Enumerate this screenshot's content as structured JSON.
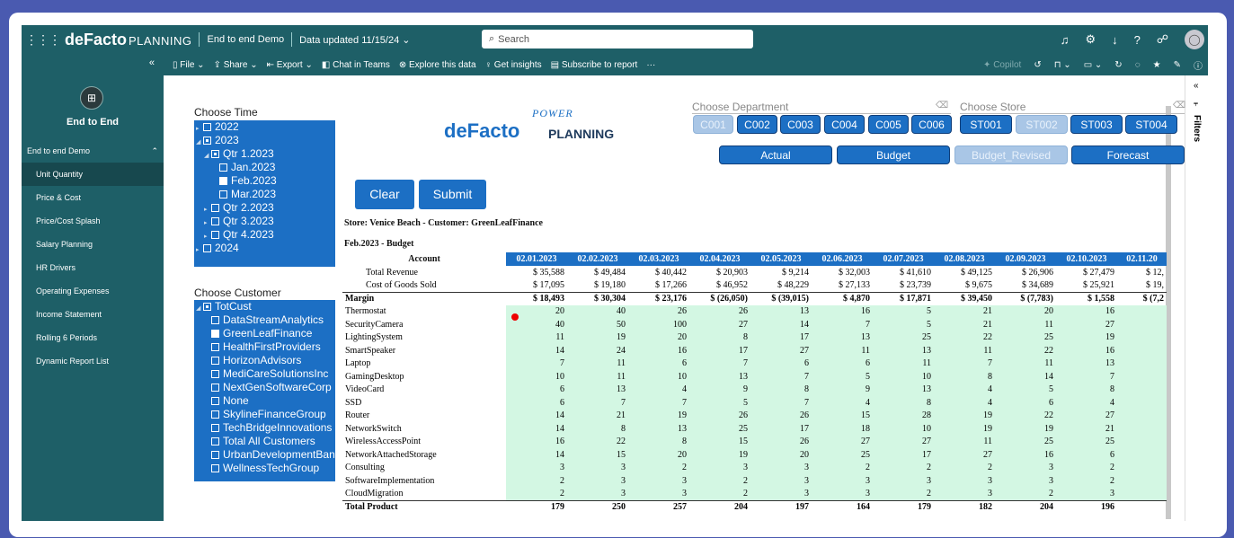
{
  "header": {
    "brand": "deFacto",
    "brand_suffix": "PLANNING",
    "report_name": "End to end Demo",
    "updated": "Data updated 11/15/24",
    "search_placeholder": "Search"
  },
  "toolbar": {
    "items": [
      "File",
      "Share",
      "Export",
      "Chat in Teams",
      "Explore this data",
      "Get insights",
      "Subscribe to report",
      "···"
    ],
    "copilot": "Copilot"
  },
  "sidebar": {
    "title": "End to End",
    "group": "End to end Demo",
    "items": [
      {
        "label": "Unit Quantity",
        "active": true
      },
      {
        "label": "Price & Cost"
      },
      {
        "label": "Price/Cost Splash"
      },
      {
        "label": "Salary Planning"
      },
      {
        "label": "HR Drivers"
      },
      {
        "label": "Operating Expenses"
      },
      {
        "label": "Income Statement"
      },
      {
        "label": "Rolling 6 Periods"
      },
      {
        "label": "Dynamic Report List"
      }
    ]
  },
  "filters_label": "Filters",
  "time_slicer": {
    "title": "Choose Time",
    "items": [
      {
        "label": "2022",
        "level": 0,
        "arrow": true,
        "check": "none"
      },
      {
        "label": "2023",
        "level": 0,
        "arrow": true,
        "check": "part",
        "open": true
      },
      {
        "label": "Qtr 1.2023",
        "level": 1,
        "arrow": true,
        "check": "part",
        "open": true
      },
      {
        "label": "Jan.2023",
        "level": 2,
        "check": "none"
      },
      {
        "label": "Feb.2023",
        "level": 2,
        "check": "full"
      },
      {
        "label": "Mar.2023",
        "level": 2,
        "check": "none"
      },
      {
        "label": "Qtr 2.2023",
        "level": 1,
        "arrow": true,
        "check": "none"
      },
      {
        "label": "Qtr 3.2023",
        "level": 1,
        "arrow": true,
        "check": "none"
      },
      {
        "label": "Qtr 4.2023",
        "level": 1,
        "arrow": true,
        "check": "none"
      },
      {
        "label": "2024",
        "level": 0,
        "arrow": true,
        "check": "none"
      }
    ]
  },
  "customer_slicer": {
    "title": "Choose Customer",
    "items": [
      {
        "label": "TotCust",
        "level": 0,
        "arrow": true,
        "check": "part",
        "open": true
      },
      {
        "label": "DataStreamAnalytics",
        "level": 1,
        "check": "none"
      },
      {
        "label": "GreenLeafFinance",
        "level": 1,
        "check": "full"
      },
      {
        "label": "HealthFirstProviders",
        "level": 1,
        "check": "none"
      },
      {
        "label": "HorizonAdvisors",
        "level": 1,
        "check": "none"
      },
      {
        "label": "MediCareSolutionsInc",
        "level": 1,
        "check": "none"
      },
      {
        "label": "NextGenSoftwareCorp",
        "level": 1,
        "check": "none"
      },
      {
        "label": "None",
        "level": 1,
        "check": "none"
      },
      {
        "label": "SkylineFinanceGroup",
        "level": 1,
        "check": "none"
      },
      {
        "label": "TechBridgeInnovations",
        "level": 1,
        "check": "none"
      },
      {
        "label": "Total All Customers",
        "level": 1,
        "check": "none"
      },
      {
        "label": "UrbanDevelopmentBank",
        "level": 1,
        "check": "none"
      },
      {
        "label": "WellnessTechGroup",
        "level": 1,
        "check": "none"
      }
    ]
  },
  "logo": {
    "power": "POWER",
    "defacto": "deFacto",
    "planning": "PLANNING"
  },
  "department": {
    "title": "Choose Department",
    "items": [
      {
        "label": "C001",
        "selected": true
      },
      {
        "label": "C002"
      },
      {
        "label": "C003"
      },
      {
        "label": "C004"
      },
      {
        "label": "C005"
      },
      {
        "label": "C006"
      }
    ]
  },
  "store": {
    "title": "Choose Store",
    "items": [
      {
        "label": "ST001"
      },
      {
        "label": "ST002",
        "selected": true
      },
      {
        "label": "ST003"
      },
      {
        "label": "ST004"
      }
    ]
  },
  "scenario": [
    {
      "label": "Actual"
    },
    {
      "label": "Budget"
    },
    {
      "label": "Budget_Revised",
      "selected": true
    },
    {
      "label": "Forecast"
    }
  ],
  "actions": {
    "clear": "Clear",
    "submit": "Submit"
  },
  "context": {
    "store_line": "Store: Venice Beach - Customer: GreenLeafFinance",
    "period_line": "Feb.2023 - Budget"
  },
  "table": {
    "account_header": "Account",
    "columns": [
      "02.01.2023",
      "02.02.2023",
      "02.03.2023",
      "02.04.2023",
      "02.05.2023",
      "02.06.2023",
      "02.07.2023",
      "02.08.2023",
      "02.09.2023",
      "02.10.2023",
      "02.11.20"
    ],
    "summary_rows": [
      {
        "label": "Total Revenue",
        "values": [
          "$ 35,588",
          "$ 49,484",
          "$ 40,442",
          "$ 20,903",
          "$ 9,214",
          "$ 32,003",
          "$ 41,610",
          "$ 49,125",
          "$ 26,906",
          "$ 27,479",
          "$ 12,"
        ]
      },
      {
        "label": "Cost of Goods Sold",
        "values": [
          "$ 17,095",
          "$ 19,180",
          "$ 17,266",
          "$ 46,952",
          "$ 48,229",
          "$ 27,133",
          "$ 23,739",
          "$ 9,675",
          "$ 34,689",
          "$ 25,921",
          "$ 19,"
        ]
      }
    ],
    "margin_row": {
      "label": "Margin",
      "values": [
        "$ 18,493",
        "$ 30,304",
        "$ 23,176",
        "$ (26,050)",
        "$ (39,015)",
        "$ 4,870",
        "$ 17,871",
        "$ 39,450",
        "$ (7,783)",
        "$ 1,558",
        "$ (7,2"
      ]
    },
    "product_rows": [
      {
        "label": "Thermostat",
        "values": [
          "20",
          "40",
          "26",
          "26",
          "13",
          "16",
          "5",
          "21",
          "20",
          "16",
          ""
        ]
      },
      {
        "label": "SecurityCamera",
        "values": [
          "40",
          "50",
          "100",
          "27",
          "14",
          "7",
          "5",
          "21",
          "11",
          "27",
          ""
        ]
      },
      {
        "label": "LightingSystem",
        "values": [
          "11",
          "19",
          "20",
          "8",
          "17",
          "13",
          "25",
          "22",
          "25",
          "19",
          ""
        ]
      },
      {
        "label": "SmartSpeaker",
        "values": [
          "14",
          "24",
          "16",
          "17",
          "27",
          "11",
          "13",
          "11",
          "22",
          "16",
          ""
        ]
      },
      {
        "label": "Laptop",
        "values": [
          "7",
          "11",
          "6",
          "7",
          "6",
          "6",
          "11",
          "7",
          "11",
          "13",
          ""
        ]
      },
      {
        "label": "GamingDesktop",
        "values": [
          "10",
          "11",
          "10",
          "13",
          "7",
          "5",
          "10",
          "8",
          "14",
          "7",
          ""
        ]
      },
      {
        "label": "VideoCard",
        "values": [
          "6",
          "13",
          "4",
          "9",
          "8",
          "9",
          "13",
          "4",
          "5",
          "8",
          ""
        ]
      },
      {
        "label": "SSD",
        "values": [
          "6",
          "7",
          "7",
          "5",
          "7",
          "4",
          "8",
          "4",
          "6",
          "4",
          ""
        ]
      },
      {
        "label": "Router",
        "values": [
          "14",
          "21",
          "19",
          "26",
          "26",
          "15",
          "28",
          "19",
          "22",
          "27",
          ""
        ]
      },
      {
        "label": "NetworkSwitch",
        "values": [
          "14",
          "8",
          "13",
          "25",
          "17",
          "18",
          "10",
          "19",
          "19",
          "21",
          ""
        ]
      },
      {
        "label": "WirelessAccessPoint",
        "values": [
          "16",
          "22",
          "8",
          "15",
          "26",
          "27",
          "27",
          "11",
          "25",
          "25",
          ""
        ]
      },
      {
        "label": "NetworkAttachedStorage",
        "values": [
          "14",
          "15",
          "20",
          "19",
          "20",
          "25",
          "17",
          "27",
          "16",
          "6",
          ""
        ]
      },
      {
        "label": "Consulting",
        "values": [
          "3",
          "3",
          "2",
          "3",
          "3",
          "2",
          "2",
          "2",
          "3",
          "2",
          ""
        ]
      },
      {
        "label": "SoftwareImplementation",
        "values": [
          "2",
          "3",
          "3",
          "2",
          "3",
          "3",
          "3",
          "3",
          "3",
          "2",
          ""
        ]
      },
      {
        "label": "CloudMigration",
        "values": [
          "2",
          "3",
          "3",
          "2",
          "3",
          "3",
          "2",
          "3",
          "2",
          "3",
          ""
        ]
      }
    ],
    "total_row": {
      "label": "Total Product",
      "values": [
        "179",
        "250",
        "257",
        "204",
        "197",
        "164",
        "179",
        "182",
        "204",
        "196",
        ""
      ]
    }
  },
  "colors": {
    "accent": "#1c6fc4",
    "nav": "#1e5f67",
    "grid_fill": "#d3f7e3",
    "backdrop": "#4a5ab0"
  }
}
